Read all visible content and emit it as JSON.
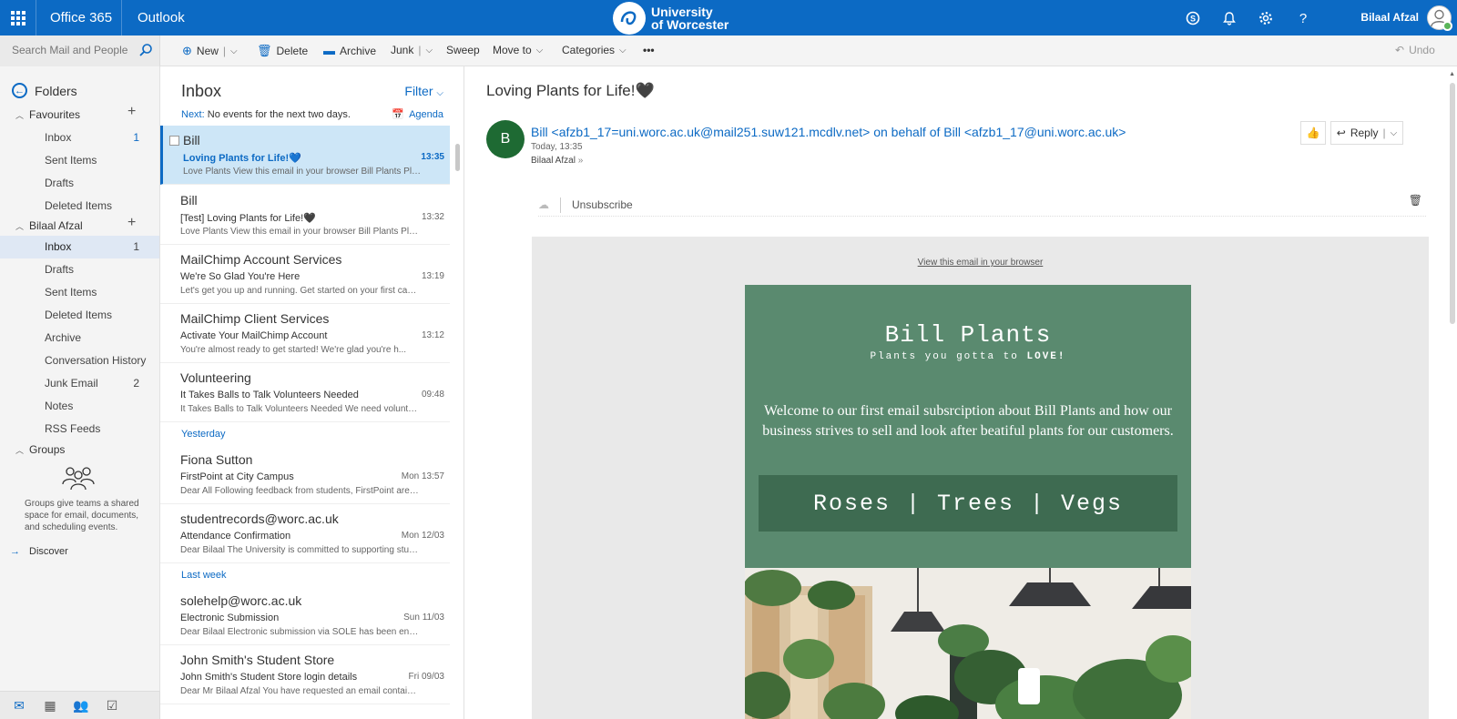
{
  "topbar": {
    "app_name": "Office 365",
    "module": "Outlook",
    "brand_line1": "University",
    "brand_line2": "of Worcester",
    "user_name": "Bilaal Afzal"
  },
  "search": {
    "placeholder": "Search Mail and People"
  },
  "toolbar": {
    "new": "New",
    "delete": "Delete",
    "archive": "Archive",
    "junk": "Junk",
    "sweep": "Sweep",
    "move_to": "Move to",
    "categories": "Categories",
    "more": "•••",
    "undo": "Undo"
  },
  "folders": {
    "heading": "Folders",
    "favourites_label": "Favourites",
    "favourites": [
      {
        "label": "Inbox",
        "count": "1"
      },
      {
        "label": "Sent Items",
        "count": ""
      },
      {
        "label": "Drafts",
        "count": ""
      },
      {
        "label": "Deleted Items",
        "count": ""
      }
    ],
    "account_label": "Bilaal Afzal",
    "account": [
      {
        "label": "Inbox",
        "count": "1"
      },
      {
        "label": "Drafts",
        "count": ""
      },
      {
        "label": "Sent Items",
        "count": ""
      },
      {
        "label": "Deleted Items",
        "count": ""
      },
      {
        "label": "Archive",
        "count": ""
      },
      {
        "label": "Conversation History",
        "count": ""
      },
      {
        "label": "Junk Email",
        "count": "2"
      },
      {
        "label": "Notes",
        "count": ""
      },
      {
        "label": "RSS Feeds",
        "count": ""
      }
    ],
    "groups_label": "Groups",
    "groups_desc": "Groups give teams a shared space for email, documents, and scheduling events.",
    "discover": "Discover"
  },
  "list": {
    "title": "Inbox",
    "filter": "Filter",
    "next_label": "Next:",
    "next_text": "No events for the next two days.",
    "agenda": "Agenda",
    "sep_yesterday": "Yesterday",
    "sep_lastweek": "Last week",
    "messages": [
      {
        "from": "Bill",
        "subject": "Loving Plants for Life!💙",
        "time": "13:35",
        "preview": "Love Plants View this email in your browser   Bill Plants Plan..."
      },
      {
        "from": "Bill",
        "subject": "[Test] Loving Plants for Life!🖤",
        "time": "13:32",
        "preview": "Love Plants View this email in your browser   Bill Plants Plan..."
      },
      {
        "from": "MailChimp Account Services",
        "subject": "We're So Glad You're Here",
        "time": "13:19",
        "preview": "Let's get you up and running.  Get started on your first cam..."
      },
      {
        "from": "MailChimp Client Services",
        "subject": "Activate Your MailChimp Account",
        "time": "13:12",
        "preview": "You're almost ready to get started!        We're glad you're h..."
      },
      {
        "from": "Volunteering",
        "subject": "It Takes Balls to Talk Volunteers Needed",
        "time": "09:48",
        "preview": "It Takes Balls to Talk Volunteers Needed  We need volunteer..."
      },
      {
        "from": "Fiona Sutton",
        "subject": "FirstPoint at City Campus",
        "time": "Mon 13:57",
        "preview": "Dear All  Following feedback from students, FirstPoint are c..."
      },
      {
        "from": "studentrecords@worc.ac.uk",
        "subject": "Attendance Confirmation",
        "time": "Mon 12/03",
        "preview": "Dear Bilaal  The University is committed to supporting stud..."
      },
      {
        "from": "solehelp@worc.ac.uk",
        "subject": "Electronic Submission",
        "time": "Sun 11/03",
        "preview": "Dear Bilaal  Electronic submission via SOLE has been enable..."
      },
      {
        "from": "John Smith's Student Store",
        "subject": "John Smith's Student Store login details",
        "time": "Fri 09/03",
        "preview": "Dear Mr Bilaal Afzal  You have requested an email containin..."
      }
    ]
  },
  "reading": {
    "subject": "Loving Plants for Life!🖤",
    "avatar_letter": "B",
    "sender": "Bill <afzb1_17=uni.worc.ac.uk@mail251.suw121.mcdlv.net> on behalf of Bill <afzb1_17@uni.worc.ac.uk>",
    "date": "Today, 13:35",
    "to": "Bilaal Afzal",
    "reply": "Reply",
    "unsubscribe": "Unsubscribe"
  },
  "email": {
    "view_in_browser": "View this email in your browser",
    "brand": "Bill Plants",
    "tagline_pre": "Plants you gotta to ",
    "tagline_bold": "LOVE!",
    "welcome": "Welcome to our first email subsrciption about Bill Plants and how our business strives to sell and look after beatiful plants for our customers.",
    "nav": "Roses | Trees | Vegs"
  },
  "colors": {
    "accent": "#0c6ac4",
    "card_green": "#5a8a6f",
    "nav_green": "#3e6b51",
    "avatar_green": "#1e6a33"
  }
}
